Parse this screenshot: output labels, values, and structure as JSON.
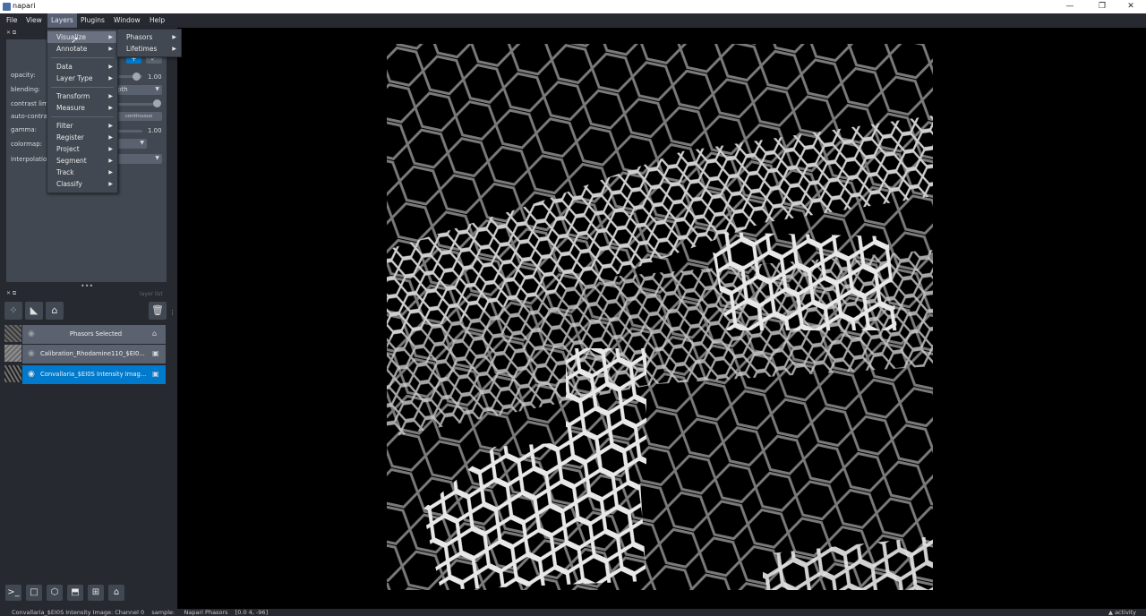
{
  "window": {
    "title": "napari",
    "min": "—",
    "max": "❐",
    "close": "✕"
  },
  "menubar": [
    "File",
    "View",
    "Layers",
    "Plugins",
    "Window",
    "Help"
  ],
  "layers_menu": {
    "group1": [
      "Visualize",
      "Annotate"
    ],
    "group2": [
      "Data",
      "Layer Type"
    ],
    "group3": [
      "Transform",
      "Measure"
    ],
    "group4": [
      "Filter",
      "Register",
      "Project",
      "Segment",
      "Track",
      "Classify"
    ]
  },
  "visualize_submenu": [
    "Phasors",
    "Lifetimes"
  ],
  "layer_controls": {
    "opacity_label": "opacity:",
    "opacity_value": "1.00",
    "blending_label": "blending:",
    "blending_value_partial": "pth",
    "contrast_label": "contrast limi",
    "autocontrast_label": "auto-contras",
    "autocontrast_btn_partial": "continuous",
    "gamma_label": "gamma:",
    "gamma_value": "1.00",
    "colormap_label": "colormap:",
    "interpolation_label": "interpolation"
  },
  "layer_list": {
    "header": "layer list",
    "layers": [
      {
        "name": "Phasors Selected",
        "type": "labels",
        "selected": false
      },
      {
        "name": "Calibration_Rhodamine110_$EI0...",
        "type": "image",
        "selected": false
      },
      {
        "name": "Convallaria_$EI0S Intensity Imag...",
        "type": "image",
        "selected": true
      }
    ]
  },
  "status": {
    "text": "Convallaria_$EI0S Intensity Image: Channel 0    sample:     Napari Phasors    [0.0 4, -96]",
    "activity": "▲ activity"
  },
  "icons": [
    "points-icon",
    "shapes-icon",
    "labels-icon",
    "delete-icon",
    "console-icon",
    "ndisplay-icon",
    "roll-icon",
    "transpose-icon",
    "grid-icon",
    "home-icon",
    "eye-icon",
    "image-icon",
    "tag-icon"
  ],
  "colors": {
    "bg": "#262930",
    "panel": "#414851",
    "accent": "#007acc",
    "row": "#5a6270"
  }
}
